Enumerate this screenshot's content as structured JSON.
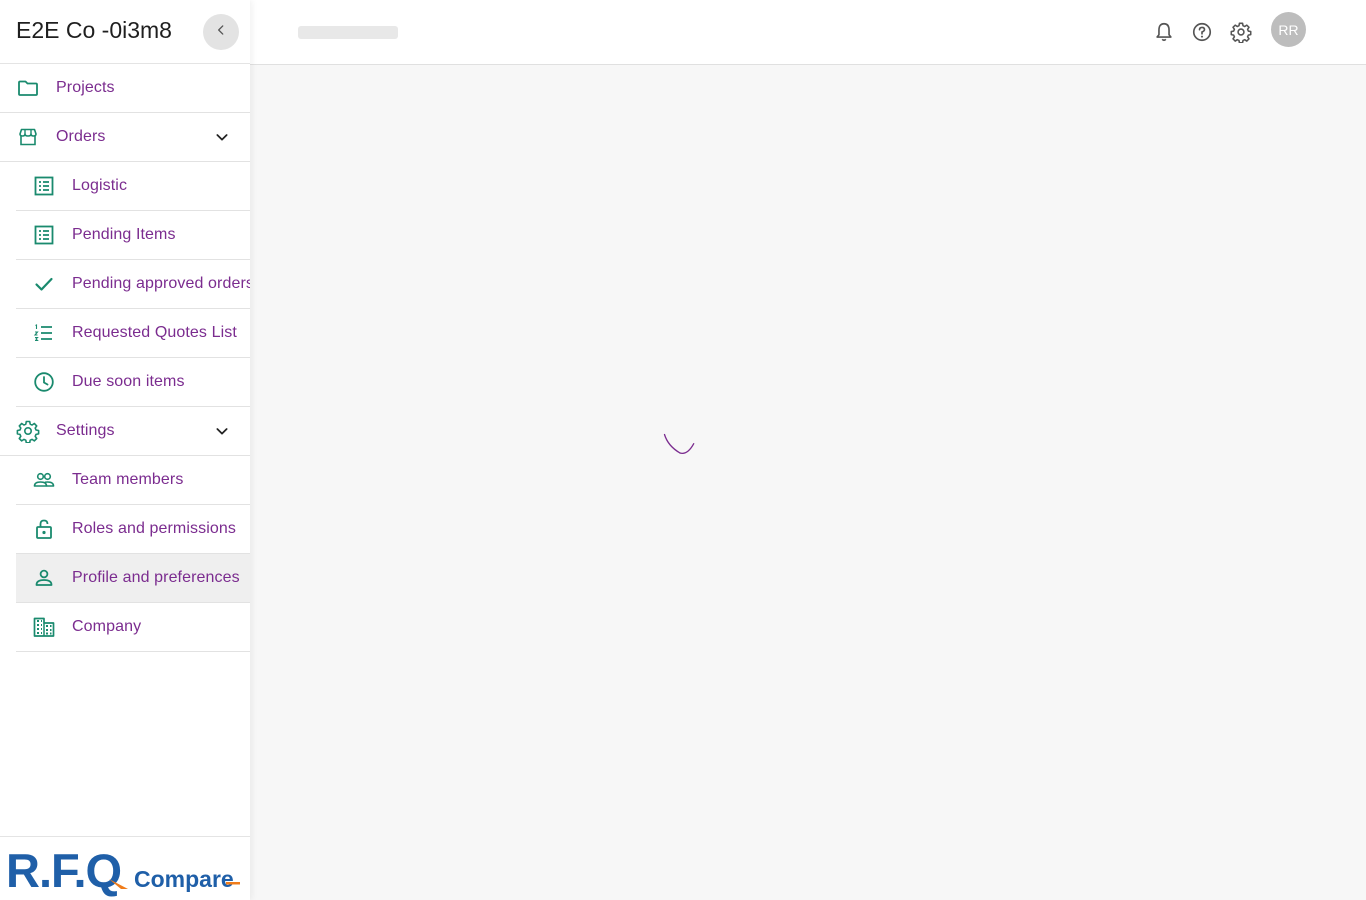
{
  "sidebar": {
    "company_name": "E2E Co -0i3m8",
    "collapse_icon": "chevron-left-icon",
    "items": [
      {
        "label": "Projects",
        "icon": "folder-icon"
      },
      {
        "label": "Orders",
        "icon": "storefront-icon",
        "expanded": true,
        "children": [
          {
            "label": "Logistic",
            "icon": "list-alt-icon"
          },
          {
            "label": "Pending Items",
            "icon": "list-alt-icon"
          },
          {
            "label": "Pending approved orders",
            "icon": "check-icon"
          },
          {
            "label": "Requested Quotes List",
            "icon": "format-list-numbered-icon"
          },
          {
            "label": "Due soon items",
            "icon": "clock-icon"
          }
        ]
      },
      {
        "label": "Settings",
        "icon": "gear-icon",
        "expanded": true,
        "children": [
          {
            "label": "Team members",
            "icon": "people-icon"
          },
          {
            "label": "Roles and permissions",
            "icon": "lock-open-icon"
          },
          {
            "label": "Profile and preferences",
            "icon": "person-icon",
            "selected": true
          },
          {
            "label": "Company",
            "icon": "domain-icon"
          }
        ]
      }
    ],
    "logo": {
      "mark": "R.F.Q",
      "text": "Compare"
    }
  },
  "header": {
    "icons": [
      "bell-icon",
      "help-icon",
      "settings-icon"
    ],
    "avatar_initials": "RR"
  },
  "main": {
    "loading": true
  },
  "colors": {
    "nav_text": "#7b2c8f",
    "icon": "#1a8a6e",
    "logo_blue": "#1f5fa8",
    "logo_orange": "#f07c1a",
    "avatar_bg": "#bdbdbd",
    "content_bg": "#f7f7f7"
  }
}
